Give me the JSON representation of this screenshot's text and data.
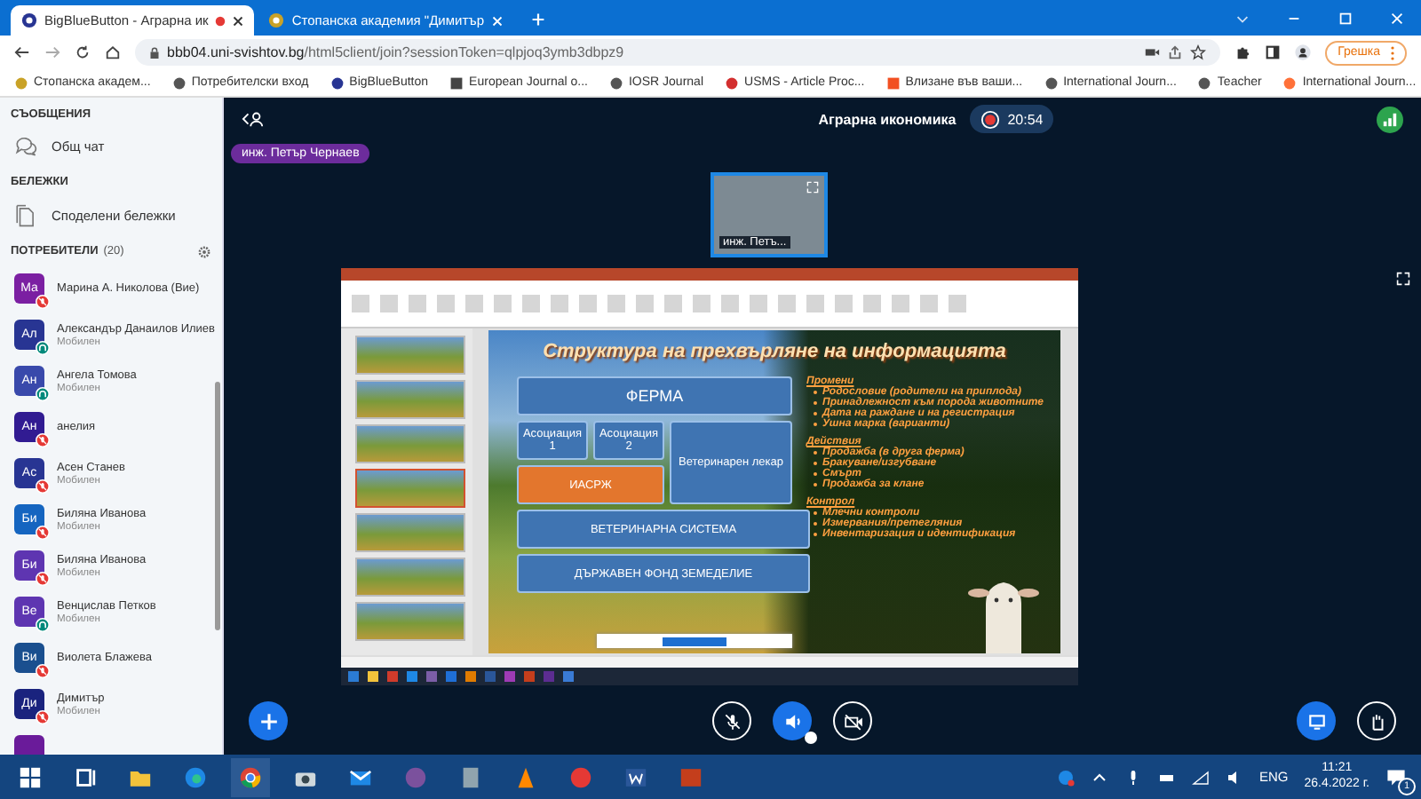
{
  "browser": {
    "tabs": [
      {
        "title": "BigBlueButton - Аграрна ик",
        "selected": true,
        "recording": true
      },
      {
        "title": "Стопанска академия \"Димитър",
        "selected": false,
        "recording": false
      }
    ],
    "address": {
      "host": "bbb04.uni-svishtov.bg",
      "path": "/html5client/join?sessionToken=qlpjoq3ymb3dbpz9"
    },
    "profile_button": "Грешка",
    "bookmarks": [
      {
        "label": "Стопанска академ...",
        "kind": "seal"
      },
      {
        "label": "Потребителски вход",
        "kind": "globe"
      },
      {
        "label": "BigBlueButton",
        "kind": "bbb"
      },
      {
        "label": "European Journal o...",
        "kind": "bank"
      },
      {
        "label": "IOSR Journal",
        "kind": "globe"
      },
      {
        "label": "USMS - Article Proc...",
        "kind": "flag"
      },
      {
        "label": "Влизане във ваши...",
        "kind": "tiles"
      },
      {
        "label": "International Journ...",
        "kind": "globe"
      },
      {
        "label": "Teacher",
        "kind": "globe"
      },
      {
        "label": "International Journ...",
        "kind": "fox"
      }
    ]
  },
  "sidebar": {
    "messages_heading": "СЪОБЩЕНИЯ",
    "public_chat": "Общ чат",
    "notes_heading": "БЕЛЕЖКИ",
    "shared_notes": "Споделени бележки",
    "users_heading": "ПОТРЕБИТЕЛИ",
    "users_count": "(20)",
    "users": [
      {
        "initials": "Ма",
        "name": "Марина А. Николова (Вие)",
        "color": "#7b1fa2",
        "kind": "muted"
      },
      {
        "initials": "Ал",
        "name": "Александър Данаилов Илиев",
        "subtitle": "Мобилен",
        "color": "#283593",
        "kind": "listen"
      },
      {
        "initials": "Ан",
        "name": "Ангела Томова",
        "subtitle": "Мобилен",
        "color": "#3949ab",
        "kind": "listen"
      },
      {
        "initials": "Ан",
        "name": "анелия",
        "color": "#311b92",
        "kind": "muted"
      },
      {
        "initials": "Ас",
        "name": "Асен Станев",
        "subtitle": "Мобилен",
        "color": "#283593",
        "kind": "muted"
      },
      {
        "initials": "Би",
        "name": "Биляна Иванова",
        "subtitle": "Мобилен",
        "color": "#1565c0",
        "kind": "muted"
      },
      {
        "initials": "Би",
        "name": "Биляна Иванова",
        "subtitle": "Мобилен",
        "color": "#5e35b1",
        "kind": "muted"
      },
      {
        "initials": "Ве",
        "name": "Венцислав Петков",
        "subtitle": "Мобилен",
        "color": "#5e35b1",
        "kind": "listen"
      },
      {
        "initials": "Ви",
        "name": "Виолета Блажева",
        "color": "#1a4f8f",
        "kind": "muted"
      },
      {
        "initials": "Ди",
        "name": "Димитър",
        "subtitle": "Мобилен",
        "color": "#1a237e",
        "kind": "muted"
      }
    ]
  },
  "meeting": {
    "title": "Аграрна икономика",
    "recording": true,
    "timer": "20:54",
    "presenter": "инж. Петър Чернаев",
    "webcam_name": "инж. Петъ..."
  },
  "slide": {
    "title": "Структура на прехвърляне на информацията",
    "boxes": [
      {
        "label": "ФЕРМА",
        "kind": "wide"
      },
      {
        "label": "Асоциация 1",
        "kind": "small"
      },
      {
        "label": "Асоциация 2",
        "kind": "small"
      },
      {
        "label": "Ветеринарен лекар",
        "kind": "tall"
      },
      {
        "label": "ИАСРЖ",
        "kind": "orange"
      },
      {
        "label": "ВЕТЕРИНАРНА СИСТЕМА",
        "kind": "full"
      },
      {
        "label": "ДЪРЖАВЕН ФОНД ЗЕМЕДЕЛИЕ",
        "kind": "full"
      }
    ],
    "groups": [
      {
        "heading": "Промени",
        "items": [
          "Родословие (родители на приплода)",
          "Принадлежност към порода животните",
          "Дата на раждане и на регистрация",
          "Ушна марка (варианти)"
        ]
      },
      {
        "heading": "Действия",
        "items": [
          "Продажба (в друга ферма)",
          "Бракуване/изгубване",
          "Смърт",
          "Продажба за клане"
        ]
      },
      {
        "heading": "Контрол",
        "items": [
          "Млечни контроли",
          "Измервания/претегляния",
          "Инвентаризация и идентификация"
        ]
      }
    ]
  },
  "taskbar": {
    "language": "ENG",
    "time": "11:21",
    "date": "26.4.2022 г.",
    "notifications": "1"
  }
}
